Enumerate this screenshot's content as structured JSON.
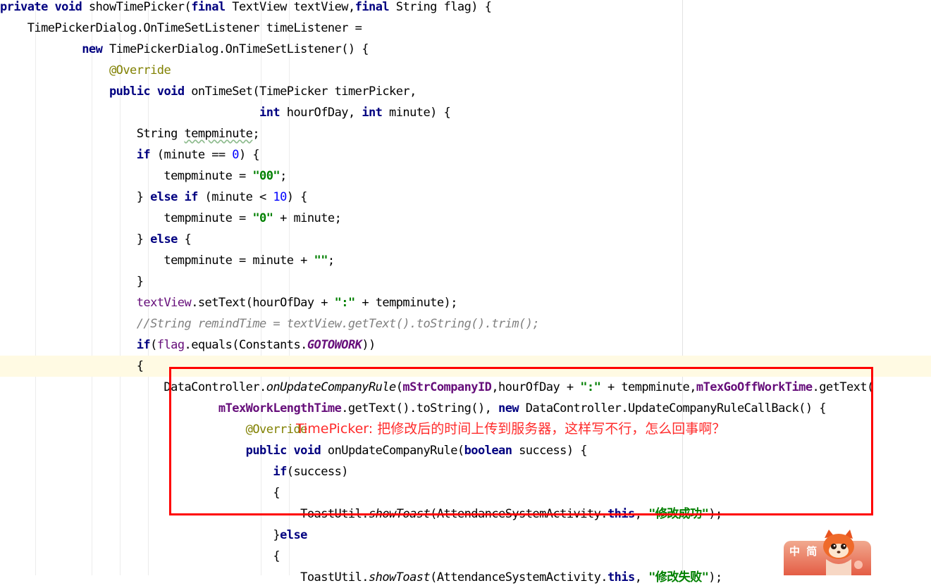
{
  "code_lines": [
    [
      {
        "t": "private void",
        "c": "kw"
      },
      {
        "t": " showTimePicker("
      },
      {
        "t": "final",
        "c": "kw"
      },
      {
        "t": " TextView textView,"
      },
      {
        "t": "final",
        "c": "kw"
      },
      {
        "t": " String flag) {"
      }
    ],
    [
      {
        "t": "    TimePickerDialog.OnTimeSetListener timeListener ="
      }
    ],
    [
      {
        "t": "            "
      },
      {
        "t": "new",
        "c": "kw"
      },
      {
        "t": " TimePickerDialog.OnTimeSetListener() {"
      }
    ],
    [
      {
        "t": "                "
      },
      {
        "t": "@Override",
        "c": "ann"
      }
    ],
    [
      {
        "t": "                "
      },
      {
        "t": "public void",
        "c": "kw"
      },
      {
        "t": " onTimeSet(TimePicker timerPicker,"
      }
    ],
    [
      {
        "t": "                                      "
      },
      {
        "t": "int",
        "c": "kw"
      },
      {
        "t": " hourOfDay, "
      },
      {
        "t": "int",
        "c": "kw"
      },
      {
        "t": " minute) {"
      }
    ],
    [
      {
        "t": "                    String "
      },
      {
        "t": "tempminute",
        "c": "wavy"
      },
      {
        "t": ";"
      }
    ],
    [
      {
        "t": "                    "
      },
      {
        "t": "if",
        "c": "kw"
      },
      {
        "t": " (minute == "
      },
      {
        "t": "0",
        "c": "num"
      },
      {
        "t": ") {"
      }
    ],
    [
      {
        "t": "                        tempminute = "
      },
      {
        "t": "\"00\"",
        "c": "str"
      },
      {
        "t": ";"
      }
    ],
    [
      {
        "t": "                    } "
      },
      {
        "t": "else if",
        "c": "kw"
      },
      {
        "t": " (minute < "
      },
      {
        "t": "10",
        "c": "num"
      },
      {
        "t": ") {"
      }
    ],
    [
      {
        "t": "                        tempminute = "
      },
      {
        "t": "\"0\"",
        "c": "str"
      },
      {
        "t": " + minute;"
      }
    ],
    [
      {
        "t": "                    } "
      },
      {
        "t": "else",
        "c": "kw"
      },
      {
        "t": " {"
      }
    ],
    [
      {
        "t": "                        tempminute = minute + "
      },
      {
        "t": "\"\"",
        "c": "str"
      },
      {
        "t": ";"
      }
    ],
    [
      {
        "t": "                    }"
      }
    ],
    [
      {
        "t": "                    "
      },
      {
        "t": "textView",
        "c": "fld"
      },
      {
        "t": ".setText(hourOfDay + "
      },
      {
        "t": "\":\"",
        "c": "str"
      },
      {
        "t": " + tempminute);"
      }
    ],
    [
      {
        "t": "                    "
      },
      {
        "t": "//String remindTime = textView.getText().toString().trim();",
        "c": "cm"
      }
    ],
    [
      {
        "t": "                    "
      },
      {
        "t": "if",
        "c": "kw"
      },
      {
        "t": "("
      },
      {
        "t": "flag",
        "c": "fld"
      },
      {
        "t": ".equals(Constants."
      },
      {
        "t": "GOTOWORK",
        "c": "fld-bi"
      },
      {
        "t": "))"
      }
    ],
    [
      {
        "t": "                    {"
      }
    ],
    [
      {
        "t": "                        DataController."
      },
      {
        "t": "onUpdateCompanyRule",
        "c": "it"
      },
      {
        "t": "("
      },
      {
        "t": "mStrCompanyID",
        "c": "fld-b"
      },
      {
        "t": ",hourOfDay + "
      },
      {
        "t": "\":\"",
        "c": "str"
      },
      {
        "t": " + tempminute,"
      },
      {
        "t": "mTexGoOffWorkTime",
        "c": "fld-b"
      },
      {
        "t": ".getText("
      }
    ],
    [
      {
        "t": "                                "
      },
      {
        "t": "mTexWorkLengthTime",
        "c": "fld-b"
      },
      {
        "t": ".getText().toString(), "
      },
      {
        "t": "new",
        "c": "kw"
      },
      {
        "t": " DataController.UpdateCompanyRuleCallBack() {"
      }
    ],
    [
      {
        "t": "                                    "
      },
      {
        "t": "@Override",
        "c": "ann"
      }
    ],
    [
      {
        "t": "                                    "
      },
      {
        "t": "public void",
        "c": "kw"
      },
      {
        "t": " onUpdateCompanyRule("
      },
      {
        "t": "boolean",
        "c": "kw"
      },
      {
        "t": " success) {"
      }
    ],
    [
      {
        "t": "                                        "
      },
      {
        "t": "if",
        "c": "kw"
      },
      {
        "t": "(success)"
      }
    ],
    [
      {
        "t": "                                        {"
      }
    ],
    [
      {
        "t": "                                            ToastUtil."
      },
      {
        "t": "showToast",
        "c": "it"
      },
      {
        "t": "(AttendanceSystemActivity."
      },
      {
        "t": "this",
        "c": "kw"
      },
      {
        "t": ", "
      },
      {
        "t": "\"修改成功\"",
        "c": "str"
      },
      {
        "t": ");"
      }
    ],
    [
      {
        "t": "                                        }"
      },
      {
        "t": "else",
        "c": "kw"
      }
    ],
    [
      {
        "t": "                                        {"
      }
    ],
    [
      {
        "t": "                                            ToastUtil."
      },
      {
        "t": "showToast",
        "c": "it"
      },
      {
        "t": "(AttendanceSystemActivity."
      },
      {
        "t": "this",
        "c": "kw"
      },
      {
        "t": ", "
      },
      {
        "t": "\"修改失败\"",
        "c": "str"
      },
      {
        "t": ");"
      }
    ]
  ],
  "current_line_index": 17,
  "annotation": {
    "text": "TimePicker:   把修改后的时间上传到服务器，这样写不行，怎么回事啊？",
    "color": "#ff2b2b"
  },
  "ime_badge": {
    "label": "中 简"
  }
}
